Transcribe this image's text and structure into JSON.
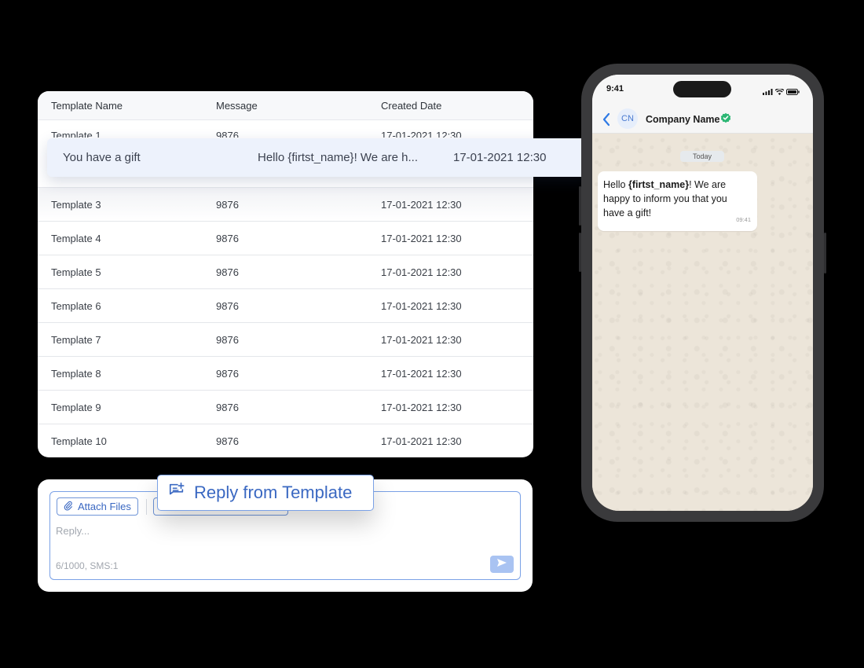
{
  "table": {
    "headers": [
      "Template Name",
      "Message",
      "Created Date"
    ],
    "partial_row": {
      "name": "Template 1",
      "message": "9876",
      "date": "17-01-2021 12:30"
    },
    "rows": [
      {
        "name": "Template 3",
        "message": "9876",
        "date": "17-01-2021 12:30"
      },
      {
        "name": "Template 4",
        "message": "9876",
        "date": "17-01-2021 12:30"
      },
      {
        "name": "Template 5",
        "message": "9876",
        "date": "17-01-2021 12:30"
      },
      {
        "name": "Template 6",
        "message": "9876",
        "date": "17-01-2021 12:30"
      },
      {
        "name": "Template 7",
        "message": "9876",
        "date": "17-01-2021 12:30"
      },
      {
        "name": "Template 8",
        "message": "9876",
        "date": "17-01-2021 12:30"
      },
      {
        "name": "Template 9",
        "message": "9876",
        "date": "17-01-2021 12:30"
      },
      {
        "name": "Template 10",
        "message": "9876",
        "date": "17-01-2021 12:30"
      }
    ]
  },
  "highlight": {
    "name": "You have a gift",
    "message": "Hello {firtst_name}! We are h...",
    "date": "17-01-2021 12:30"
  },
  "reply": {
    "attach_label": "Attach Files",
    "template_button_label": "Reply from Template",
    "placeholder": "Reply...",
    "counter": "6/1000, SMS:1"
  },
  "phone": {
    "time": "9:41",
    "avatar_initials": "CN",
    "company_name": "Company Name",
    "today_label": "Today",
    "message": {
      "pre": "Hello ",
      "bold": "{firtst_name}",
      "post": "! We are happy to inform you that you have a gift!",
      "time": "09:41"
    }
  },
  "colors": {
    "accent": "#3a68c2",
    "highlight_bg": "#edf2fc",
    "verified": "#2bb673"
  }
}
